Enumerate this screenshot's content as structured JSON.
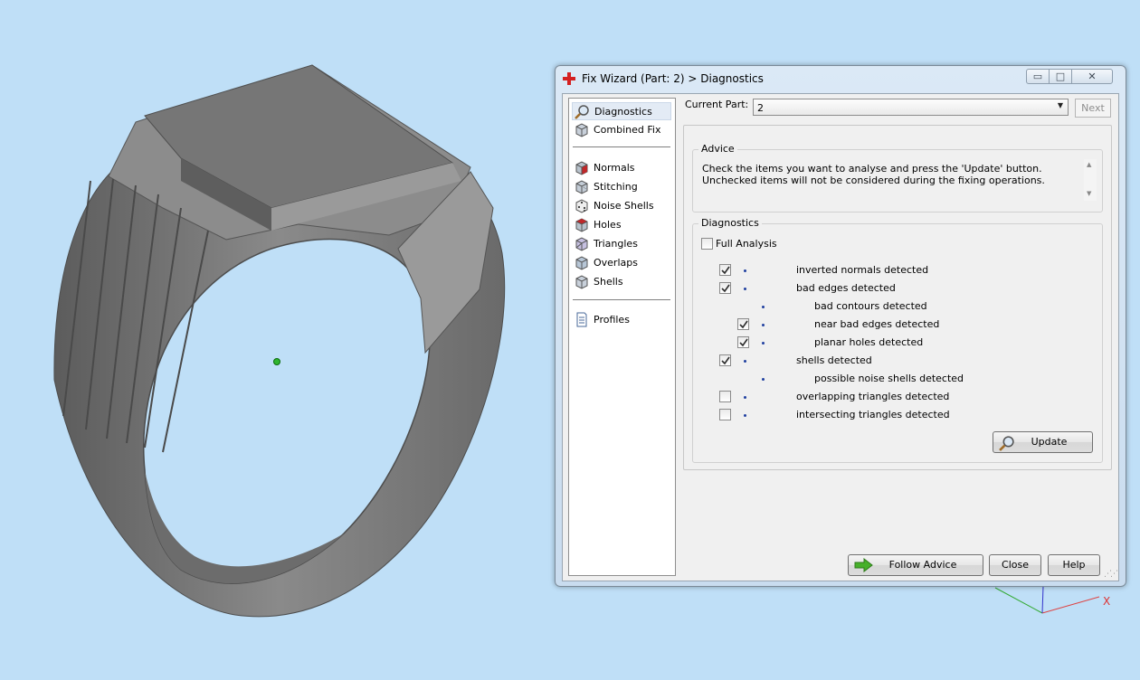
{
  "window": {
    "title": "Fix Wizard (Part: 2) > Diagnostics",
    "min_glyph": "▭",
    "max_glyph": "□",
    "close_glyph": "✕"
  },
  "nav": {
    "primary": [
      {
        "label": "Diagnostics",
        "icon": "magnifier-icon"
      },
      {
        "label": "Combined Fix",
        "icon": "cube-icon"
      }
    ],
    "tools": [
      {
        "label": "Normals",
        "icon": "normals-cube-icon"
      },
      {
        "label": "Stitching",
        "icon": "stitching-cube-icon"
      },
      {
        "label": "Noise Shells",
        "icon": "noise-shells-dice-icon"
      },
      {
        "label": "Holes",
        "icon": "holes-cube-icon"
      },
      {
        "label": "Triangles",
        "icon": "triangles-cube-icon"
      },
      {
        "label": "Overlaps",
        "icon": "overlaps-cube-icon"
      },
      {
        "label": "Shells",
        "icon": "shells-cube-icon"
      }
    ],
    "extra": [
      {
        "label": "Profiles",
        "icon": "document-icon"
      }
    ]
  },
  "current_part": {
    "label": "Current Part:",
    "value": "2",
    "next_label": "Next"
  },
  "advice": {
    "title": "Advice",
    "text": "Check the items you want to analyse and press the 'Update' button. Unchecked items will not be considered during the fixing operations."
  },
  "diagnostics": {
    "title": "Diagnostics",
    "full_analysis_label": "Full Analysis",
    "full_analysis_checked": false,
    "rows": [
      {
        "label": "inverted normals detected",
        "checked": true
      },
      {
        "label": "bad edges detected",
        "checked": true
      },
      {
        "label": "bad contours detected",
        "checked": null
      },
      {
        "label": "near bad edges detected",
        "checked": true
      },
      {
        "label": "planar holes detected",
        "checked": true
      },
      {
        "label": "shells detected",
        "checked": true
      },
      {
        "label": "possible noise shells detected",
        "checked": null
      },
      {
        "label": "overlapping triangles detected",
        "checked": false
      },
      {
        "label": "intersecting triangles detected",
        "checked": false
      }
    ],
    "update_label": "Update"
  },
  "footer": {
    "follow_advice_label": "Follow Advice",
    "close_label": "Close",
    "help_label": "Help"
  },
  "colors": {
    "viewport_bg": "#bfdff7",
    "ring_grey": "#7d7d7d",
    "selection": "#e3ebf5"
  },
  "axis": {
    "x_label": "X"
  }
}
